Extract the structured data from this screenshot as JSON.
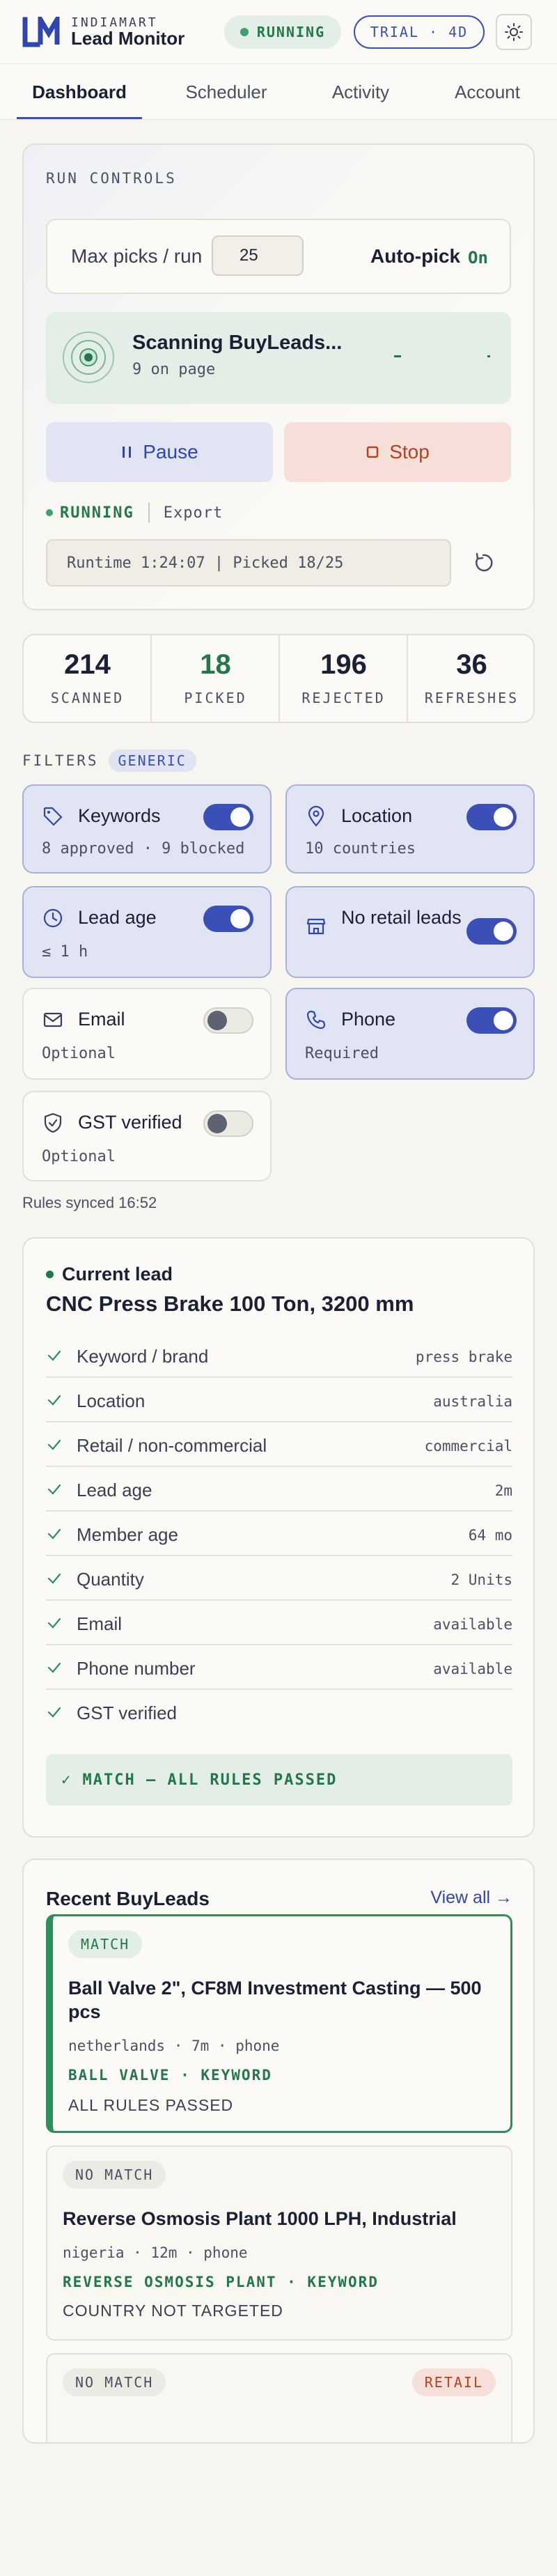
{
  "app": {
    "brand_small": "INDIAMART",
    "brand_name": "Lead Monitor",
    "status_pill": "RUNNING",
    "trial_pill": "TRIAL · 4D"
  },
  "tabs": [
    {
      "label": "Dashboard",
      "active": true
    },
    {
      "label": "Scheduler",
      "active": false
    },
    {
      "label": "Activity",
      "active": false
    },
    {
      "label": "Account",
      "active": false
    }
  ],
  "run_controls": {
    "title": "RUN CONTROLS",
    "max_picks_label": "Max picks / run",
    "max_picks_value": "25",
    "autopick_label": "Auto-pick",
    "autopick_value": "On",
    "scan_title": "Scanning BuyLeads...",
    "scan_sub": "9 on page",
    "pause_label": "Pause",
    "stop_label": "Stop",
    "status_text": "RUNNING",
    "export_label": "Export",
    "runtime_text": "Runtime 1:24:07 | Picked 18/25"
  },
  "stats": [
    {
      "value": "214",
      "label": "SCANNED"
    },
    {
      "value": "18",
      "label": "PICKED"
    },
    {
      "value": "196",
      "label": "REJECTED"
    },
    {
      "value": "36",
      "label": "REFRESHES"
    }
  ],
  "filters": {
    "title": "FILTERS",
    "badge": "GENERIC",
    "items": [
      {
        "title": "Keywords",
        "sub": "8 approved · 9 blocked",
        "on": true,
        "icon": "tag-icon"
      },
      {
        "title": "Location",
        "sub": "10 countries",
        "on": true,
        "icon": "map-pin-icon"
      },
      {
        "title": "Lead age",
        "sub": "≤ 1 h",
        "on": true,
        "icon": "clock-icon"
      },
      {
        "title": "No retail leads",
        "sub": "",
        "on": true,
        "icon": "store-icon"
      },
      {
        "title": "Email",
        "sub": "Optional",
        "on": false,
        "icon": "mail-icon"
      },
      {
        "title": "Phone",
        "sub": "Required",
        "on": true,
        "icon": "phone-icon"
      },
      {
        "title": "GST verified",
        "sub": "Optional",
        "on": false,
        "icon": "shield-check-icon"
      }
    ],
    "synced": "Rules synced 16:52"
  },
  "current_lead": {
    "label": "Current lead",
    "title": "CNC Press Brake 100 Ton, 3200 mm",
    "rules": [
      {
        "name": "Keyword / brand",
        "value": "press brake"
      },
      {
        "name": "Location",
        "value": "australia"
      },
      {
        "name": "Retail / non-commercial",
        "value": "commercial"
      },
      {
        "name": "Lead age",
        "value": "2m"
      },
      {
        "name": "Member age",
        "value": "64 mo"
      },
      {
        "name": "Quantity",
        "value": "2 Units"
      },
      {
        "name": "Email",
        "value": "available"
      },
      {
        "name": "Phone number",
        "value": "available"
      },
      {
        "name": "GST verified",
        "value": ""
      }
    ],
    "result": "✓ MATCH — ALL RULES PASSED"
  },
  "recent": {
    "title": "Recent BuyLeads",
    "view_all": "View all →",
    "items": [
      {
        "badge": "MATCH",
        "title": "Ball Valve 2\", CF8M Investment Casting — 500 pcs",
        "meta": "netherlands · 7m · phone",
        "keyword": "BALL VALVE · KEYWORD",
        "reason": "ALL RULES PASSED"
      },
      {
        "badge": "NO MATCH",
        "title": "Reverse Osmosis Plant 1000 LPH, Industrial",
        "meta": "nigeria · 12m · phone",
        "keyword": "REVERSE OSMOSIS PLANT · KEYWORD",
        "reason": "COUNTRY NOT TARGETED"
      },
      {
        "badge": "NO MATCH",
        "tag": "RETAIL"
      }
    ]
  },
  "colors": {
    "accent": "#3a50b8",
    "success": "#23784b",
    "danger": "#b2431f",
    "background": "#f6f5ef"
  }
}
